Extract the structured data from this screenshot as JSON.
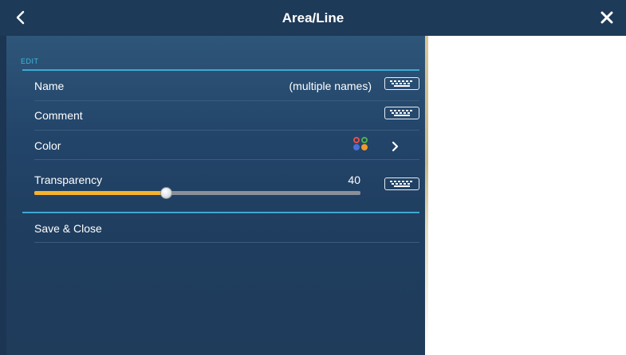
{
  "header": {
    "title": "Area/Line",
    "back_icon": "chevron-left-icon",
    "close_icon": "close-x-icon"
  },
  "section": {
    "label": "EDIT"
  },
  "rows": {
    "name": {
      "label": "Name",
      "value": "(multiple names)"
    },
    "comment": {
      "label": "Comment"
    },
    "color": {
      "label": "Color"
    },
    "transparency": {
      "label": "Transparency",
      "value": "40"
    },
    "save": {
      "label": "Save & Close"
    }
  },
  "colors": {
    "header_bg": "#1d3a58",
    "panel_bg": "#23456a",
    "accent_line": "#3da9d3",
    "slider_fill": "#f7b22c",
    "dot_red": "#e5504a",
    "dot_green": "#4fb14f",
    "dot_blue": "#4a6fd8",
    "dot_orange": "#f09a2a"
  }
}
